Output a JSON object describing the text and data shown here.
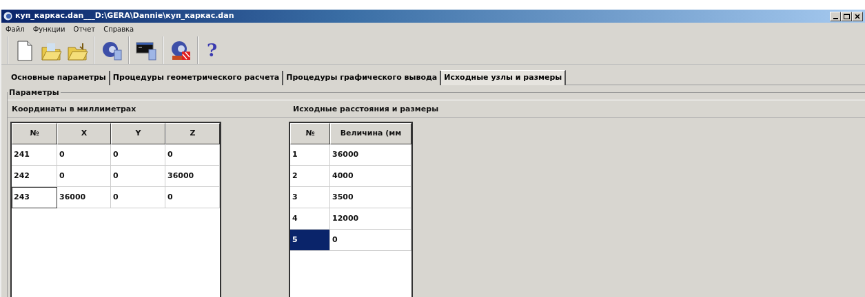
{
  "window": {
    "title": "куп_каркас.dan___D:\\GERA\\Dannie\\куп_каркас.dan"
  },
  "menu": [
    "Файл",
    "Функции",
    "Отчет",
    "Справка"
  ],
  "toolbar": [
    [
      {
        "kind": "new"
      },
      {
        "kind": "open"
      },
      {
        "kind": "save"
      }
    ],
    [
      {
        "kind": "globe"
      }
    ],
    [
      {
        "kind": "terminal"
      }
    ],
    [
      {
        "kind": "globe_stop"
      }
    ],
    [
      {
        "kind": "help",
        "label": "?"
      }
    ]
  ],
  "tabs": [
    {
      "label": "Основные параметры",
      "selected": false
    },
    {
      "label": "Процедуры геометрического расчета",
      "selected": false
    },
    {
      "label": "Процедуры графического вывода",
      "selected": false
    },
    {
      "label": "Исходные узлы и размеры",
      "selected": true
    }
  ],
  "group_title": "Параметры",
  "nodes": {
    "title": "Координаты в миллиметрах",
    "columns": [
      "№",
      "X",
      "Y",
      "Z"
    ],
    "rows": [
      {
        "cells": [
          "241",
          "0",
          "0",
          "0"
        ],
        "focused": false
      },
      {
        "cells": [
          "242",
          "0",
          "0",
          "36000"
        ],
        "focused": false
      },
      {
        "cells": [
          "243",
          "36000",
          "0",
          "0"
        ],
        "focused": true
      }
    ]
  },
  "sizes": {
    "title": "Исходные расстояния и размеры",
    "columns": [
      "№",
      "Величина (мм"
    ],
    "rows": [
      {
        "cells": [
          "1",
          "36000"
        ],
        "selected": false
      },
      {
        "cells": [
          "2",
          "4000"
        ],
        "selected": false
      },
      {
        "cells": [
          "3",
          "3500"
        ],
        "selected": false
      },
      {
        "cells": [
          "4",
          "12000"
        ],
        "selected": false
      },
      {
        "cells": [
          "5",
          "0"
        ],
        "selected": true
      }
    ]
  }
}
